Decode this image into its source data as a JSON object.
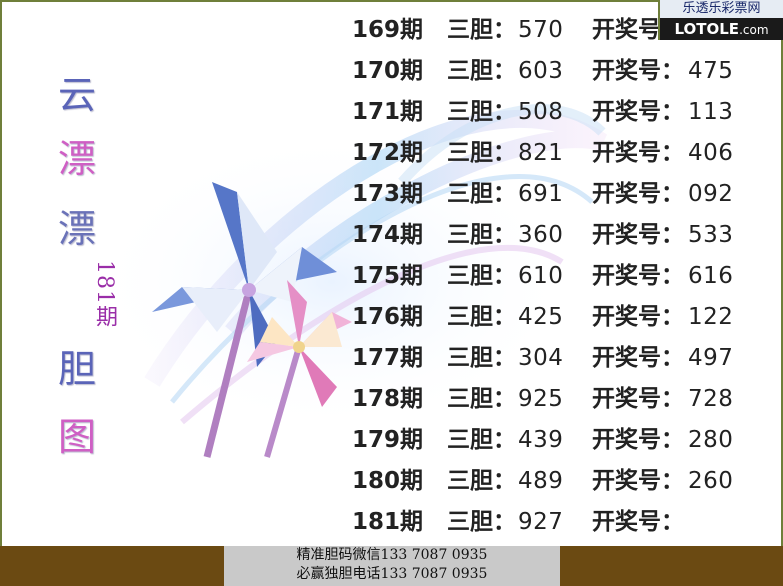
{
  "site": {
    "logo_cn": "乐透乐彩票网",
    "logo_en": "LOTOLE",
    "logo_domain": ".com"
  },
  "title_chars": [
    {
      "char": "云",
      "color": "#5a64b8"
    },
    {
      "char": "漂",
      "color": "#cf5fc4"
    },
    {
      "char": "漂",
      "color": "#6a72b8"
    },
    {
      "char": "胆",
      "color": "#5a64b8"
    },
    {
      "char": "图",
      "color": "#cf5fc4"
    }
  ],
  "issue_tag": "181期",
  "labels": {
    "dan": "三胆：",
    "win": "开奖号："
  },
  "rows": [
    {
      "period": "169期",
      "dan": "570",
      "win": ""
    },
    {
      "period": "170期",
      "dan": "603",
      "win": "475"
    },
    {
      "period": "171期",
      "dan": "508",
      "win": "113"
    },
    {
      "period": "172期",
      "dan": "821",
      "win": "406"
    },
    {
      "period": "173期",
      "dan": "691",
      "win": "092"
    },
    {
      "period": "174期",
      "dan": "360",
      "win": "533"
    },
    {
      "period": "175期",
      "dan": "610",
      "win": "616"
    },
    {
      "period": "176期",
      "dan": "425",
      "win": "122"
    },
    {
      "period": "177期",
      "dan": "304",
      "win": "497"
    },
    {
      "period": "178期",
      "dan": "925",
      "win": "728"
    },
    {
      "period": "179期",
      "dan": "439",
      "win": "280"
    },
    {
      "period": "180期",
      "dan": "489",
      "win": "260"
    },
    {
      "period": "181期",
      "dan": "927",
      "win": ""
    }
  ],
  "footer": {
    "line1": "精准胆码微信133  7087  0935",
    "line2": "必赢独胆电话133  7087  0935"
  },
  "colors": {
    "border": "#6f7f3a",
    "bottom_bar": "#6b4a12",
    "footer_bg": "#c9c9c9",
    "text": "#222222"
  }
}
